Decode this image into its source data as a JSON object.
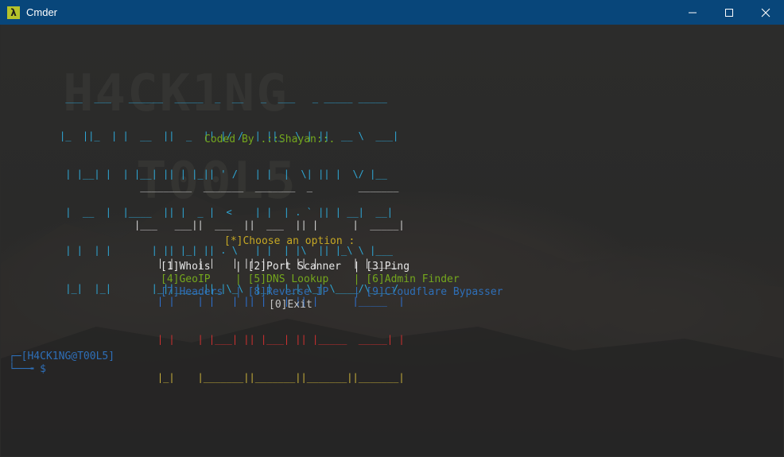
{
  "window": {
    "title": "Cmder",
    "app_icon_glyph": "λ",
    "accent_color": "#08467a"
  },
  "banner": {
    "hacking_art": [
      " ___  ___   ______  _____  _  __   _  ___   _ _____ _____",
      "|_  ||_  | |  __  ||  _  || |/ /  | ||_  \\ | ||  __ \\  ___|",
      " | |__| |  | |__| || | |_|| ' /   | |  |  \\| || |  \\/ |__",
      " |  __  |  |____  || |  _ |  <    | |  | . ` || | __|  __|",
      " | |  | |       | || |_| || . \\   | |  | |\\  || |_\\ \\ |___",
      " |_|  |_|       |_||_____||_|\\_\\  |_|  |_| \\_| \\____/\\____/"
    ],
    "coded_by": "Coded By .::Shayan::.",
    "tools_art_top": [
      " _________  _______  _______  _        _______",
      "|___   ___||  ___  ||  ___  || |      |  _____|",
      "    | |    | |   | || |   | || |      | |_____"
    ],
    "tools_art_mid": [
      "    | |    | |   | || |   | || |      |_____  |"
    ],
    "tools_art_red": [
      "    | |    | |___| || |___| || |_____  _____| |"
    ],
    "tools_art_bottom": [
      "    |_|    |_______||_______||_______||_______|"
    ]
  },
  "menu": {
    "prompt": "[*]Choose an option :",
    "row1": "[1]Whois    | [2]Port Scanner  | [3]Ping",
    "row2": "[4]GeoIP    | [5]DNS Lookup    | [6]Admin Finder",
    "row3": "[7]Headers  | [8]Reverse IP    | [9]Cloudflare Bypasser",
    "exit": "[0]Exit"
  },
  "shell": {
    "prompt_line1": "┌─[H4CK1NG@T00L5]",
    "prompt_line2": "└──╼ $"
  }
}
